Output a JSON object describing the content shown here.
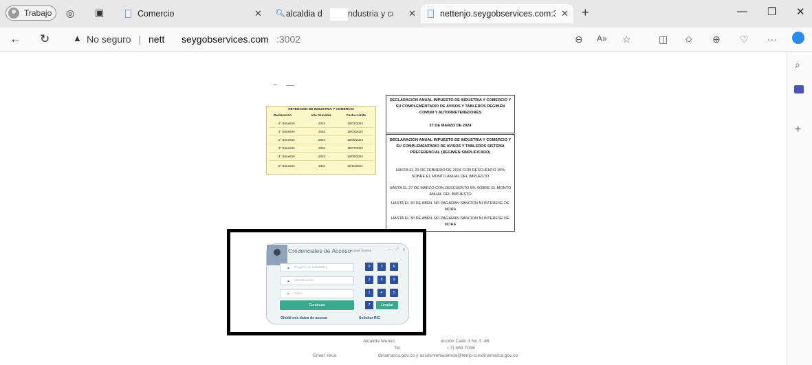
{
  "browser": {
    "profile_label": "Trabajo",
    "tabs": [
      {
        "title": "Comercio"
      },
      {
        "title": "alcaldia d",
        "title_rest": "ndustria y come"
      },
      {
        "title": "nettenjo.seygobservices.com:300"
      }
    ],
    "new_tab_symbol": "+",
    "close_symbol": "✕",
    "address": {
      "security_label": "No seguro",
      "separator": "|",
      "host_start": "nett",
      "host_rest": "seygobservices.com",
      "port": ":3002"
    }
  },
  "retencion": {
    "title": "RETENCION DE INDUSTRIA Y COMERCIO",
    "headers": [
      "Declaración",
      "Año Gravable",
      "Fecha Límite"
    ],
    "rows": [
      [
        "6° Bimestre",
        "2023",
        "15/01/2024"
      ],
      [
        "1° Bimestre",
        "2024",
        "15/03/2024"
      ],
      [
        "2° Bimestre",
        "2024",
        "15/05/2024"
      ],
      [
        "3° Bimestre",
        "2024",
        "15/07/2024"
      ],
      [
        "4° Bimestre",
        "2024",
        "16/09/2024"
      ],
      [
        "5° Bimestre",
        "2024",
        "15/11/2024"
      ]
    ]
  },
  "decl1": {
    "title": "DECLARACION ANUAL IMPUESTO DE INDUSTRIA Y COMERCIO Y SU COMPLEMENTARIO DE AVISOS Y TABLEROS REGIMEN COMUN Y AUTORRETENEDORES",
    "date": "27 DE MARZO DE 2024"
  },
  "decl2": {
    "title": "DECLARACION ANUAL IMPUESTO DE INDUSTRIA Y COMERCIO Y SU COMPLEMENTARIO DE AVISOS Y TABLEROS SISTEMA PREFERENCIAL (REGIMEN SIMPLIFICADO)",
    "lines": [
      "HASTA EL 29 DE FEBRERO DE 2024 CON DESCUENTO 15% SOBRE EL MONTO ANUAL DEL IMPUESTO",
      "HASTA EL 27 DE MARZO CON DESCUENTO 5% SOBRE EL MONTO ANUAL DEL IMPUESTO",
      "HASTA EL 30 DE ABRIL NO PAGARAN SANCION NI INTERESE DE MORA",
      "HASTA EL 30 DE ABRIL NO PAGARAN SANCION NI INTERESE DE MORA"
    ]
  },
  "login": {
    "title": "Credenciales de Acceso",
    "subtitle": "Huawei Service",
    "fields": [
      "Registro de Industria y",
      "Identificación",
      "Clave"
    ],
    "submit_label": "Continuar",
    "keys": [
      "0",
      "3",
      "6",
      "2",
      "8",
      "9",
      "1",
      "4",
      "5",
      "7"
    ],
    "clear_label": "Limpiar",
    "forgot_label": "Olvidé mis datos de acceso",
    "request_label": "Solicitar RIC"
  },
  "footer": {
    "line1_a": "Alcaldía Munici",
    "line1_b": "ección Calle 3 No 3 -86",
    "line2_a": "Tel",
    "line2_b": "i 7) 459 7018",
    "line3_a": "Email: reca",
    "line3_b": "dinamarca.gov.co y asistentehacienda@tenjo-cundinamarca.gov.co"
  }
}
